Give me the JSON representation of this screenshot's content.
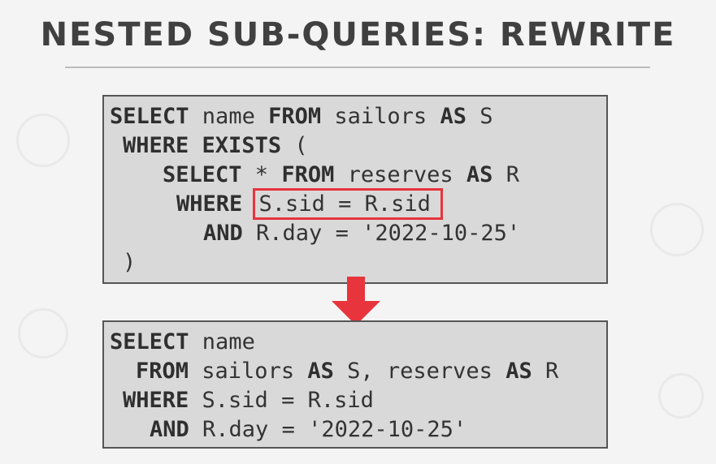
{
  "slide": {
    "title": "NESTED SUB-QUERIES: REWRITE"
  },
  "query_before": {
    "l1": {
      "k1": "SELECT",
      "t1": " name ",
      "k2": "FROM",
      "t2": " sailors ",
      "k3": "AS",
      "t3": " S"
    },
    "l2": {
      "k1": "WHERE",
      "t1": " ",
      "k2": "EXISTS",
      "t2": " ("
    },
    "l3": {
      "k1": "SELECT",
      "t1": " * ",
      "k2": "FROM",
      "t2": " reserves ",
      "k3": "AS",
      "t3": " R"
    },
    "l4": {
      "k1": "WHERE",
      "t1": " ",
      "h1": "S.sid = R.sid"
    },
    "l5": {
      "k1": "AND",
      "t1": " R.day = '2022-10-25'"
    },
    "l6": {
      "t1": ")"
    }
  },
  "query_after": {
    "l1": {
      "k1": "SELECT",
      "t1": " name"
    },
    "l2": {
      "k1": "FROM",
      "t1": " sailors ",
      "k2": "AS",
      "t2": " S, reserves ",
      "k3": "AS",
      "t3": " R"
    },
    "l3": {
      "k1": "WHERE",
      "t1": " S.sid = R.sid"
    },
    "l4": {
      "k1": "AND",
      "t1": " R.day = '2022-10-25'"
    }
  },
  "colors": {
    "highlight": "#e8343d",
    "arrow": "#e8343d",
    "box_bg": "#d9d9d9"
  }
}
